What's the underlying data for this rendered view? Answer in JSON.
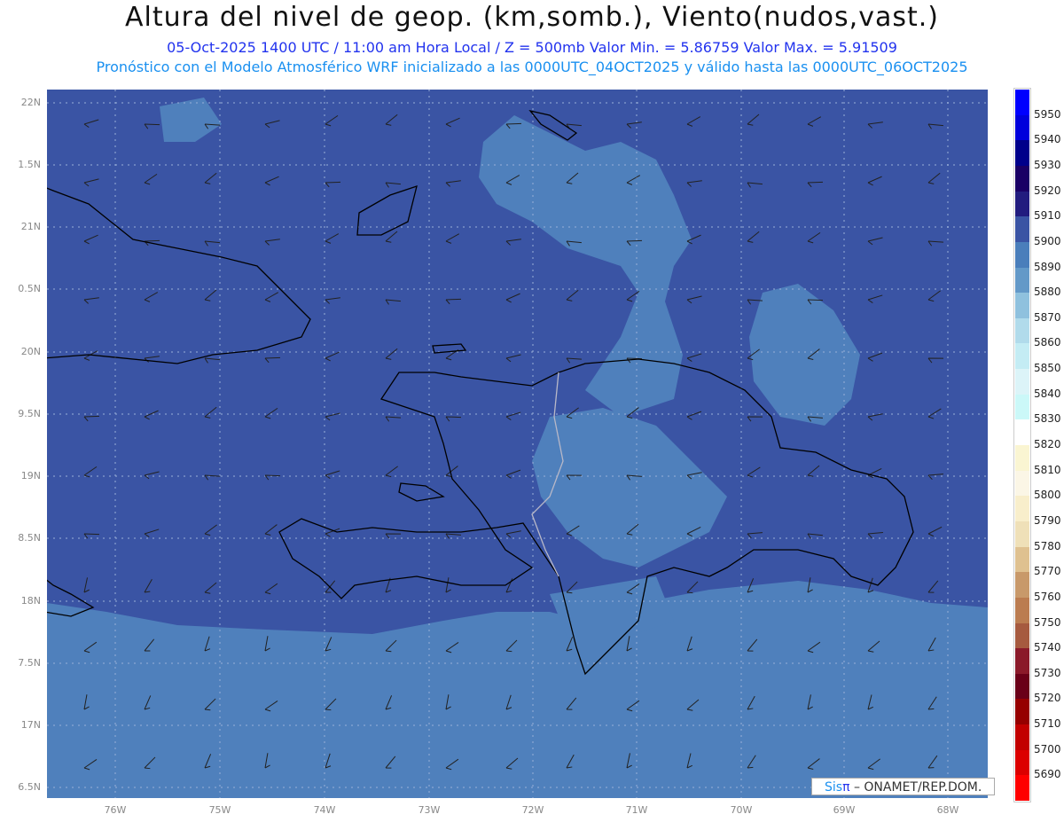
{
  "header": {
    "title": "Altura del nivel de geop. (km,somb.), Viento(nudos,vast.)",
    "subtitle": "05-Oct-2025  1400 UTC / 11:00 am Hora Local / Z = 500mb    Valor Min. = 5.86759   Valor Max. = 5.91509",
    "model_line": "Pronóstico con el Modelo Atmosférico WRF inicializado a las 0000UTC_04OCT2025 y válido hasta las  0000UTC_06OCT2025"
  },
  "map": {
    "lat_labels": [
      "22N",
      "1.5N",
      "21N",
      "0.5N",
      "20N",
      "9.5N",
      "19N",
      "8.5N",
      "18N",
      "7.5N",
      "17N",
      "6.5N"
    ],
    "lon_labels": [
      "76W",
      "75W",
      "74W",
      "73W",
      "72W",
      "71W",
      "70W",
      "69W",
      "68W"
    ],
    "colors": {
      "dark": "#3a54a4",
      "light": "#4f80bc",
      "lighter": "#6399c8"
    }
  },
  "colorbar": {
    "labels": [
      "5950",
      "5940",
      "5930",
      "5920",
      "5910",
      "5900",
      "5890",
      "5880",
      "5870",
      "5860",
      "5850",
      "5840",
      "5830",
      "5820",
      "5810",
      "5800",
      "5790",
      "5780",
      "5770",
      "5760",
      "5750",
      "5740",
      "5730",
      "5720",
      "5710",
      "5700",
      "5690"
    ],
    "colors": [
      "#0000ff",
      "#0000dc",
      "#00008b",
      "#1a0066",
      "#221c7f",
      "#3a54a4",
      "#4a7ebb",
      "#6399c8",
      "#8fc1de",
      "#b1dbeb",
      "#c4ecf4",
      "#dcf4f8",
      "#cbf8f8",
      "#ffffff",
      "#faf5d2",
      "#fbf6e6",
      "#f8eecb",
      "#efe0b8",
      "#dfc190",
      "#c8996a",
      "#bb7c50",
      "#a65a3f",
      "#8b1a2a",
      "#6a0018",
      "#960000",
      "#c20000",
      "#dc0000",
      "#ff0000"
    ]
  },
  "watermark": {
    "sis": "Sis",
    "pi": "π",
    "rest": " –  ONAMET/REP.DOM."
  }
}
